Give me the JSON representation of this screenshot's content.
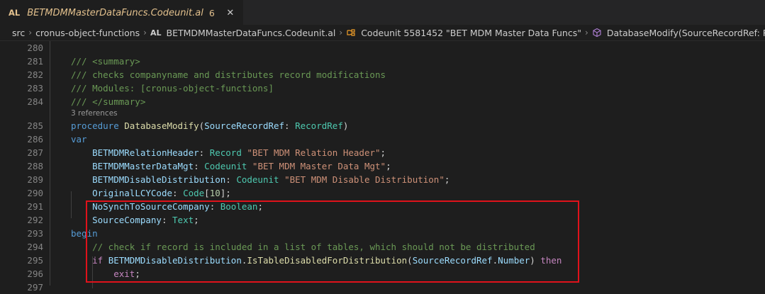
{
  "tab": {
    "lang": "AL",
    "filename": "BETMDMMasterDataFuncs.Codeunit.al",
    "problems": "6",
    "close": "✕"
  },
  "breadcrumb": {
    "src": "src",
    "folder": "cronus-object-functions",
    "file_lang": "AL",
    "file": "BETMDMMasterDataFuncs.Codeunit.al",
    "object": "Codeunit 5581452 \"BET MDM Master Data Funcs\"",
    "method": "DatabaseModify(SourceRecordRef: RecordRef)"
  },
  "code": {
    "l280": {
      "num": "280"
    },
    "l281": {
      "num": "281",
      "text": "/// <summary>"
    },
    "l282": {
      "num": "282",
      "text": "/// checks companyname and distributes record modifications"
    },
    "l283": {
      "num": "283",
      "text": "/// Modules: [cronus-object-functions]"
    },
    "l284": {
      "num": "284",
      "text": "/// </summary>"
    },
    "lens": "3 references",
    "l285": {
      "num": "285",
      "kw": "procedure",
      "name": "DatabaseModify",
      "open": "(",
      "param": "SourceRecordRef",
      "colon": ": ",
      "type": "RecordRef",
      "close": ")"
    },
    "l286": {
      "num": "286",
      "kw": "var"
    },
    "l287": {
      "num": "287",
      "name": "BETMDMRelationHeader",
      "colon": ": ",
      "type": "Record",
      "str": "\"BET MDM Relation Header\"",
      "end": ";"
    },
    "l288": {
      "num": "288",
      "name": "BETMDMMasterDataMgt",
      "colon": ": ",
      "type": "Codeunit",
      "str": "\"BET MDM Master Data Mgt\"",
      "end": ";"
    },
    "l289": {
      "num": "289",
      "name": "BETMDMDisableDistribution",
      "colon": ": ",
      "type": "Codeunit",
      "str": "\"BET MDM Disable Distribution\"",
      "end": ";"
    },
    "l290": {
      "num": "290",
      "name": "OriginalLCYCode",
      "colon": ": ",
      "type": "Code",
      "open": "[",
      "n": "10",
      "close": "];"
    },
    "l291": {
      "num": "291",
      "name": "NoSynchToSourceCompany",
      "colon": ": ",
      "type": "Boolean",
      "end": ";"
    },
    "l292": {
      "num": "292",
      "name": "SourceCompany",
      "colon": ": ",
      "type": "Text",
      "end": ";"
    },
    "l293": {
      "num": "293",
      "kw": "begin"
    },
    "l294": {
      "num": "294",
      "text": "// check if record is included in a list of tables, which should not be distributed"
    },
    "l295": {
      "num": "295",
      "if": "if",
      "obj": "BETMDMDisableDistribution",
      "dot": ".",
      "fn": "IsTableDisabledForDistribution",
      "open": "(",
      "arg": "SourceRecordRef",
      "dot2": ".",
      "prop": "Number",
      "close": ")",
      "then": "then"
    },
    "l296": {
      "num": "296",
      "exit": "exit",
      "end": ";"
    },
    "l297": {
      "num": "297"
    }
  },
  "colors": {
    "highlight_border": "#e0121b",
    "tab_modified": "#e2c08d"
  }
}
